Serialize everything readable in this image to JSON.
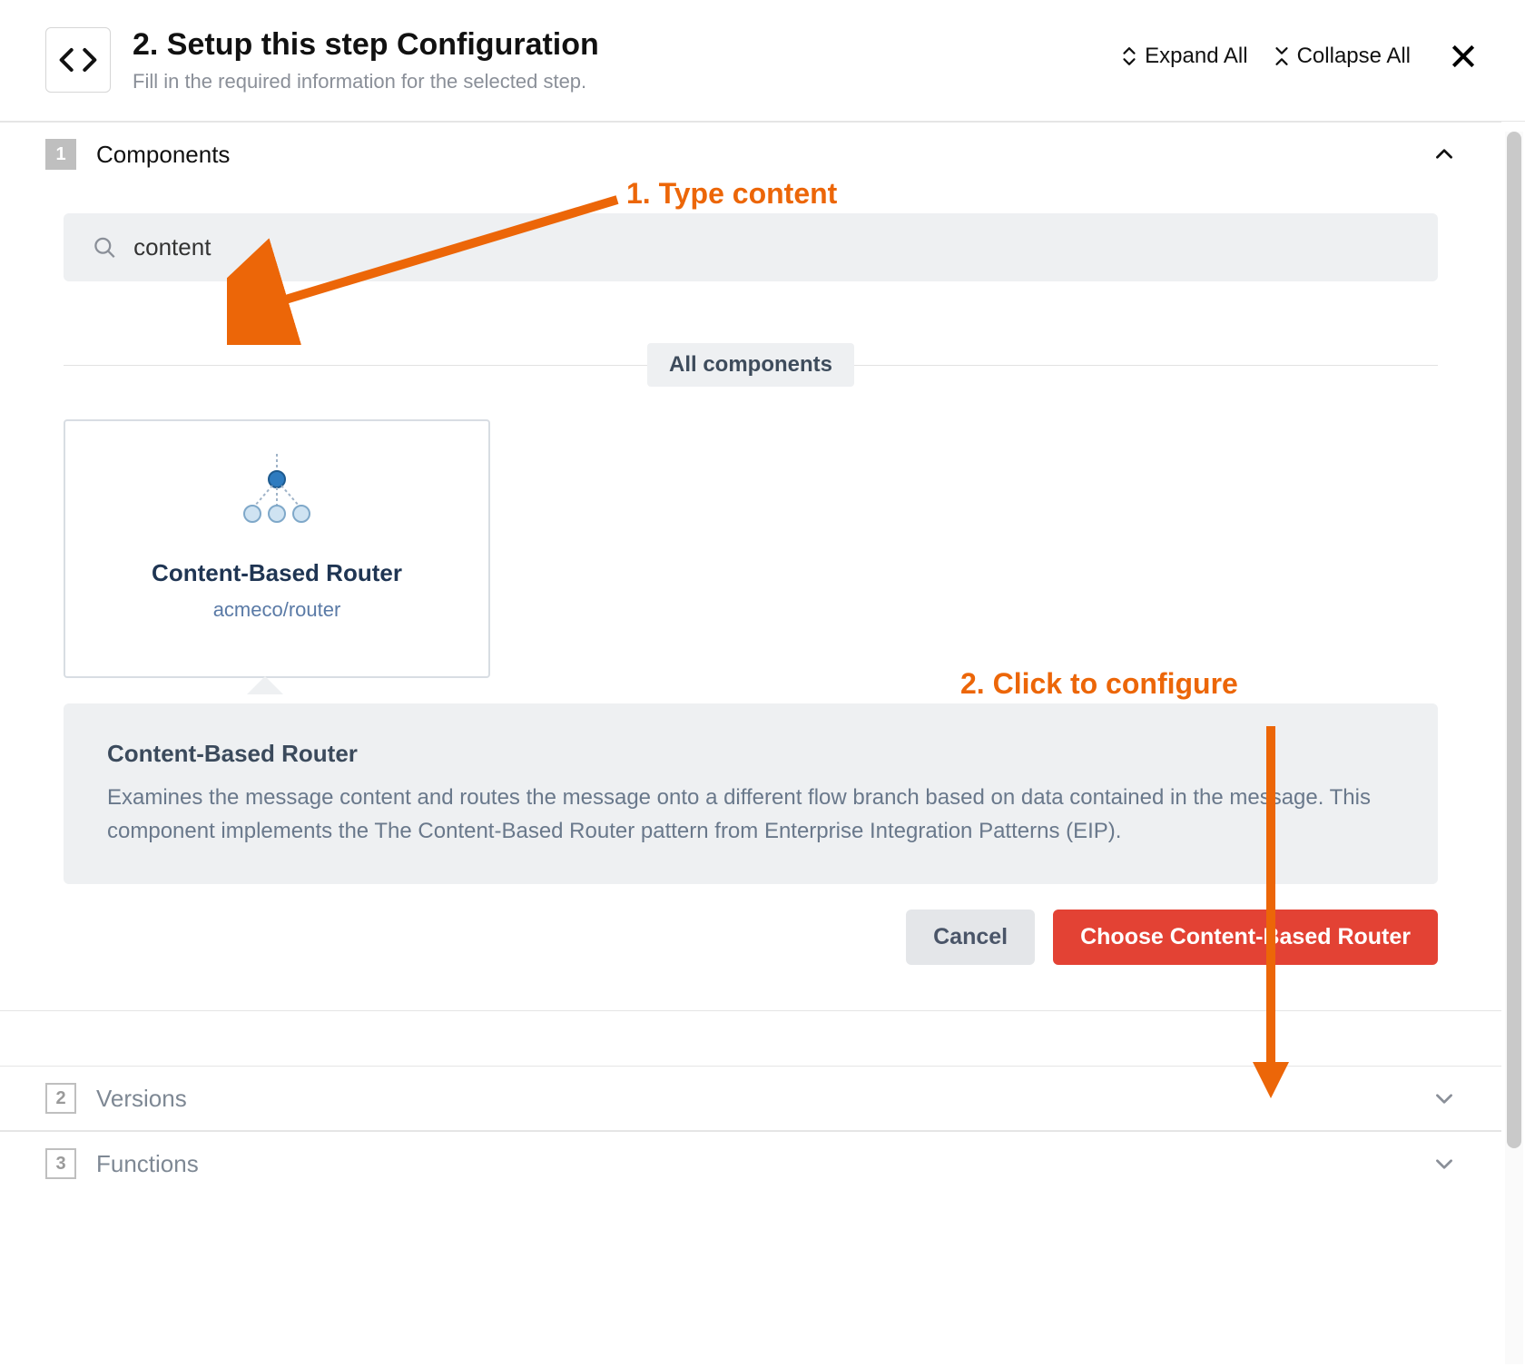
{
  "header": {
    "title": "2. Setup this step Configuration",
    "subtitle": "Fill in the required information for the selected step.",
    "expand_all": "Expand All",
    "collapse_all": "Collapse All"
  },
  "sections": [
    {
      "num": "1",
      "title": "Components",
      "active": true,
      "expanded": true
    },
    {
      "num": "2",
      "title": "Versions",
      "active": false,
      "expanded": false
    },
    {
      "num": "3",
      "title": "Functions",
      "active": false,
      "expanded": false
    }
  ],
  "search": {
    "value": "content"
  },
  "divider_label": "All components",
  "card": {
    "title": "Content-Based Router",
    "subtitle": "acmeco/router"
  },
  "detail": {
    "title": "Content-Based Router",
    "text": "Examines the message content and routes the message onto a different flow branch based on data contained in the message. This component implements the The Content-Based Router pattern from Enterprise Integration Patterns (EIP)."
  },
  "buttons": {
    "cancel": "Cancel",
    "choose": "Choose Content-Based Router"
  },
  "annotations": {
    "a1": "1. Type content",
    "a2": "2. Click to configure"
  },
  "colors": {
    "accent": "#ec6608",
    "primary_btn": "#e34234"
  }
}
